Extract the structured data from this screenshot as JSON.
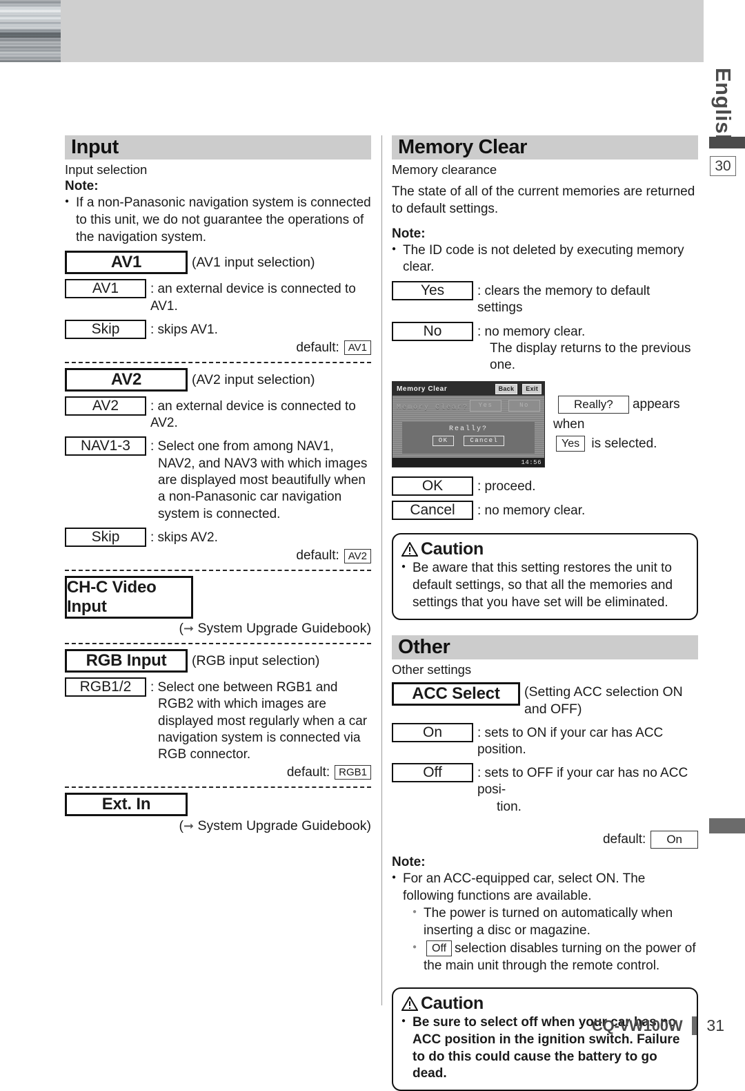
{
  "page": {
    "language_tab": "English",
    "chapter_number": "30",
    "model": "CQ-VW100W",
    "page_number": "31"
  },
  "left_column": {
    "section": {
      "title": "Input",
      "subtitle": "Input selection",
      "note_label": "Note:",
      "notes": [
        "If a non-Panasonic navigation system is connected to this unit, we do not guarantee the operations of the navigation system."
      ]
    },
    "groups": [
      {
        "name": "AV1",
        "paren": "(AV1 input selection)",
        "options": [
          {
            "label": "AV1",
            "desc": ": an external device is connected to AV1."
          },
          {
            "label": "Skip",
            "desc": ": skips AV1."
          }
        ],
        "default_label": "default:",
        "default_value": "AV1"
      },
      {
        "name": "AV2",
        "paren": "(AV2 input selection)",
        "options": [
          {
            "label": "AV2",
            "desc": ": an external device is connected to AV2."
          },
          {
            "label": "NAV1-3",
            "desc": ": Select one from among NAV1, NAV2, and NAV3 with which images are displayed most beautifully when a non-Panasonic car navigation system is connected."
          },
          {
            "label": "Skip",
            "desc": ": skips AV2."
          }
        ],
        "default_label": "default:",
        "default_value": "AV2"
      },
      {
        "name": "CH-C Video Input",
        "paren": "",
        "reference": "System Upgrade Guidebook"
      },
      {
        "name": "RGB Input",
        "paren": "(RGB input selection)",
        "options": [
          {
            "label": "RGB1/2",
            "desc": ": Select one between RGB1 and RGB2 with which images are displayed most regularly when a car navigation system is connected via RGB connector."
          }
        ],
        "default_label": "default:",
        "default_value": "RGB1"
      },
      {
        "name": "Ext. In",
        "paren": "",
        "reference": "System Upgrade Guidebook"
      }
    ]
  },
  "right_column": {
    "memory_clear": {
      "title": "Memory Clear",
      "subtitle": "Memory clearance",
      "paragraph": "The state of all of the current memories are returned to default settings.",
      "note_label": "Note:",
      "notes": [
        "The ID code is not deleted by executing memory clear."
      ],
      "options": [
        {
          "label": "Yes",
          "desc": ": clears the memory to default settings"
        },
        {
          "label": "No",
          "desc": ": no memory clear.",
          "desc2": "The display returns to the previous one."
        }
      ],
      "screenshot": {
        "title": "Memory Clear",
        "back_button": "Back",
        "exit_button": "Exit",
        "prompt": "Memory Clear?",
        "yes_button": "Yes",
        "no_button": "No",
        "dialog_text": "Really?",
        "ok_button": "OK",
        "cancel_button": "Cancel",
        "clock": "14:56"
      },
      "screenshot_caption": {
        "chip1": "Really?",
        "text1": "appears when",
        "chip2": "Yes",
        "text2": "is selected."
      },
      "confirm_options": [
        {
          "label": "OK",
          "desc": ": proceed."
        },
        {
          "label": "Cancel",
          "desc": ": no memory clear."
        }
      ],
      "caution": {
        "heading": "Caution",
        "items": [
          "Be aware that this setting restores the unit to default settings, so that all the memories and settings that you have set will be eliminated."
        ]
      }
    },
    "other": {
      "title": "Other",
      "subtitle": "Other settings",
      "group": {
        "name": "ACC Select",
        "paren": "(Setting ACC selection ON and OFF)",
        "options": [
          {
            "label": "On",
            "desc": ": sets to ON if your car has ACC position."
          },
          {
            "label": "Off",
            "desc": ": sets to OFF if your car has no ACC posi-",
            "desc2": "tion."
          }
        ],
        "default_label": "default:",
        "default_value": "On"
      },
      "note_label": "Note:",
      "notes": [
        "For an ACC-equipped car, select ON.  The following functions are available.",
        "The power is turned on automatically when inserting a disc or magazine."
      ],
      "note_off_chip": "Off",
      "note_off_text": "selection disables turning on the power of the main unit through the remote control.",
      "caution": {
        "heading": "Caution",
        "items": [
          "Be sure to select off when your car has no ACC position in the ignition switch. Failure to do this could cause the battery to go dead."
        ]
      }
    }
  }
}
